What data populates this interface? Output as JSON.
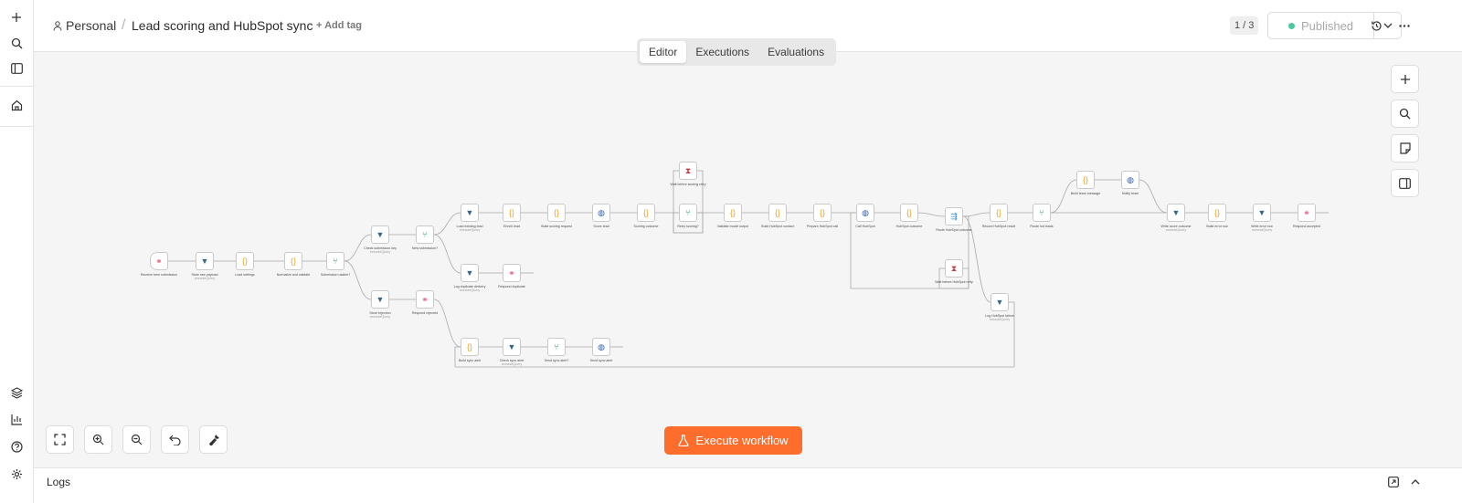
{
  "header": {
    "project": "Personal",
    "separator": "/",
    "title": "Lead scoring and HubSpot sync",
    "add_tag": "+ Add tag",
    "version": "1 / 3",
    "publish_label": "Published"
  },
  "tabs": [
    "Editor",
    "Executions",
    "Evaluations"
  ],
  "execute_label": "Execute workflow",
  "logs_label": "Logs",
  "nodes": [
    {
      "label": "Receive form submission",
      "sub": "",
      "kind": "webhook",
      "color": "#e8446b"
    },
    {
      "label": "Store raw payload",
      "sub": "executeQuery",
      "kind": "db",
      "color": "#336791"
    },
    {
      "label": "Load settings",
      "sub": "",
      "kind": "code",
      "color": "#f5a623"
    },
    {
      "label": "Normalize and validate",
      "sub": "",
      "kind": "code",
      "color": "#f5a623"
    },
    {
      "label": "Submission usable?",
      "sub": "",
      "kind": "if",
      "color": "#1e9e6a"
    },
    {
      "label": "Check submission key",
      "sub": "executeQuery",
      "kind": "db",
      "color": "#336791"
    },
    {
      "label": "New submission?",
      "sub": "",
      "kind": "if",
      "color": "#1e9e6a"
    },
    {
      "label": "Load existing lead",
      "sub": "executeQuery",
      "kind": "db",
      "color": "#336791"
    },
    {
      "label": "Enrich lead",
      "sub": "",
      "kind": "code",
      "color": "#f5a623"
    },
    {
      "label": "Build scoring request",
      "sub": "",
      "kind": "code",
      "color": "#f5a623"
    },
    {
      "label": "Score lead",
      "sub": "",
      "kind": "http",
      "color": "#2a5cad"
    },
    {
      "label": "Scoring outcome",
      "sub": "",
      "kind": "code",
      "color": "#f5a623"
    },
    {
      "label": "Retry scoring?",
      "sub": "",
      "kind": "if",
      "color": "#1e9e6a"
    },
    {
      "label": "Wait before scoring retry",
      "sub": "",
      "kind": "wait",
      "color": "#c94040"
    },
    {
      "label": "Validate model output",
      "sub": "",
      "kind": "code",
      "color": "#f5a623"
    },
    {
      "label": "Build HubSpot contact",
      "sub": "",
      "kind": "code",
      "color": "#f5a623"
    },
    {
      "label": "Prepare HubSpot call",
      "sub": "",
      "kind": "code",
      "color": "#f5a623"
    },
    {
      "label": "Call HubSpot",
      "sub": "",
      "kind": "http",
      "color": "#2a5cad"
    },
    {
      "label": "HubSpot outcome",
      "sub": "",
      "kind": "code",
      "color": "#f5a623"
    },
    {
      "label": "Route HubSpot outcome",
      "sub": "",
      "kind": "switch",
      "color": "#3d8fd6"
    },
    {
      "label": "Wait before HubSpot retry",
      "sub": "",
      "kind": "wait",
      "color": "#c94040"
    },
    {
      "label": "Record HubSpot result",
      "sub": "",
      "kind": "code",
      "color": "#f5a623"
    },
    {
      "label": "Route hot leads",
      "sub": "",
      "kind": "if",
      "color": "#1e9e6a"
    },
    {
      "label": "Build team message",
      "sub": "",
      "kind": "code",
      "color": "#f5a623"
    },
    {
      "label": "Notify team",
      "sub": "",
      "kind": "http",
      "color": "#2a5cad"
    },
    {
      "label": "Write score outcome",
      "sub": "executeQuery",
      "kind": "db",
      "color": "#336791"
    },
    {
      "label": "Build error row",
      "sub": "",
      "kind": "code",
      "color": "#f5a623"
    },
    {
      "label": "Write error row",
      "sub": "executeQuery",
      "kind": "db",
      "color": "#336791"
    },
    {
      "label": "Respond accepted",
      "sub": "",
      "kind": "webhook",
      "color": "#e8446b"
    },
    {
      "label": "Log duplicate delivery",
      "sub": "executeQuery",
      "kind": "db",
      "color": "#336791"
    },
    {
      "label": "Respond duplicate",
      "sub": "",
      "kind": "webhook",
      "color": "#e8446b"
    },
    {
      "label": "Log HubSpot failure",
      "sub": "executeQuery",
      "kind": "db",
      "color": "#336791"
    },
    {
      "label": "Store rejection",
      "sub": "executeQuery",
      "kind": "db",
      "color": "#336791"
    },
    {
      "label": "Respond rejected",
      "sub": "",
      "kind": "webhook",
      "color": "#e8446b"
    },
    {
      "label": "Build sync alert",
      "sub": "",
      "kind": "code",
      "color": "#f5a623"
    },
    {
      "label": "Check sync alert",
      "sub": "executeQuery",
      "kind": "db",
      "color": "#336791"
    },
    {
      "label": "Send sync alert?",
      "sub": "",
      "kind": "if",
      "color": "#1e9e6a"
    },
    {
      "label": "Send sync alert",
      "sub": "",
      "kind": "http",
      "color": "#2a5cad"
    }
  ],
  "colors": {
    "accent": "#ff6d2d",
    "published": "#4cc9a2",
    "canvas": "#f5f5f5"
  }
}
